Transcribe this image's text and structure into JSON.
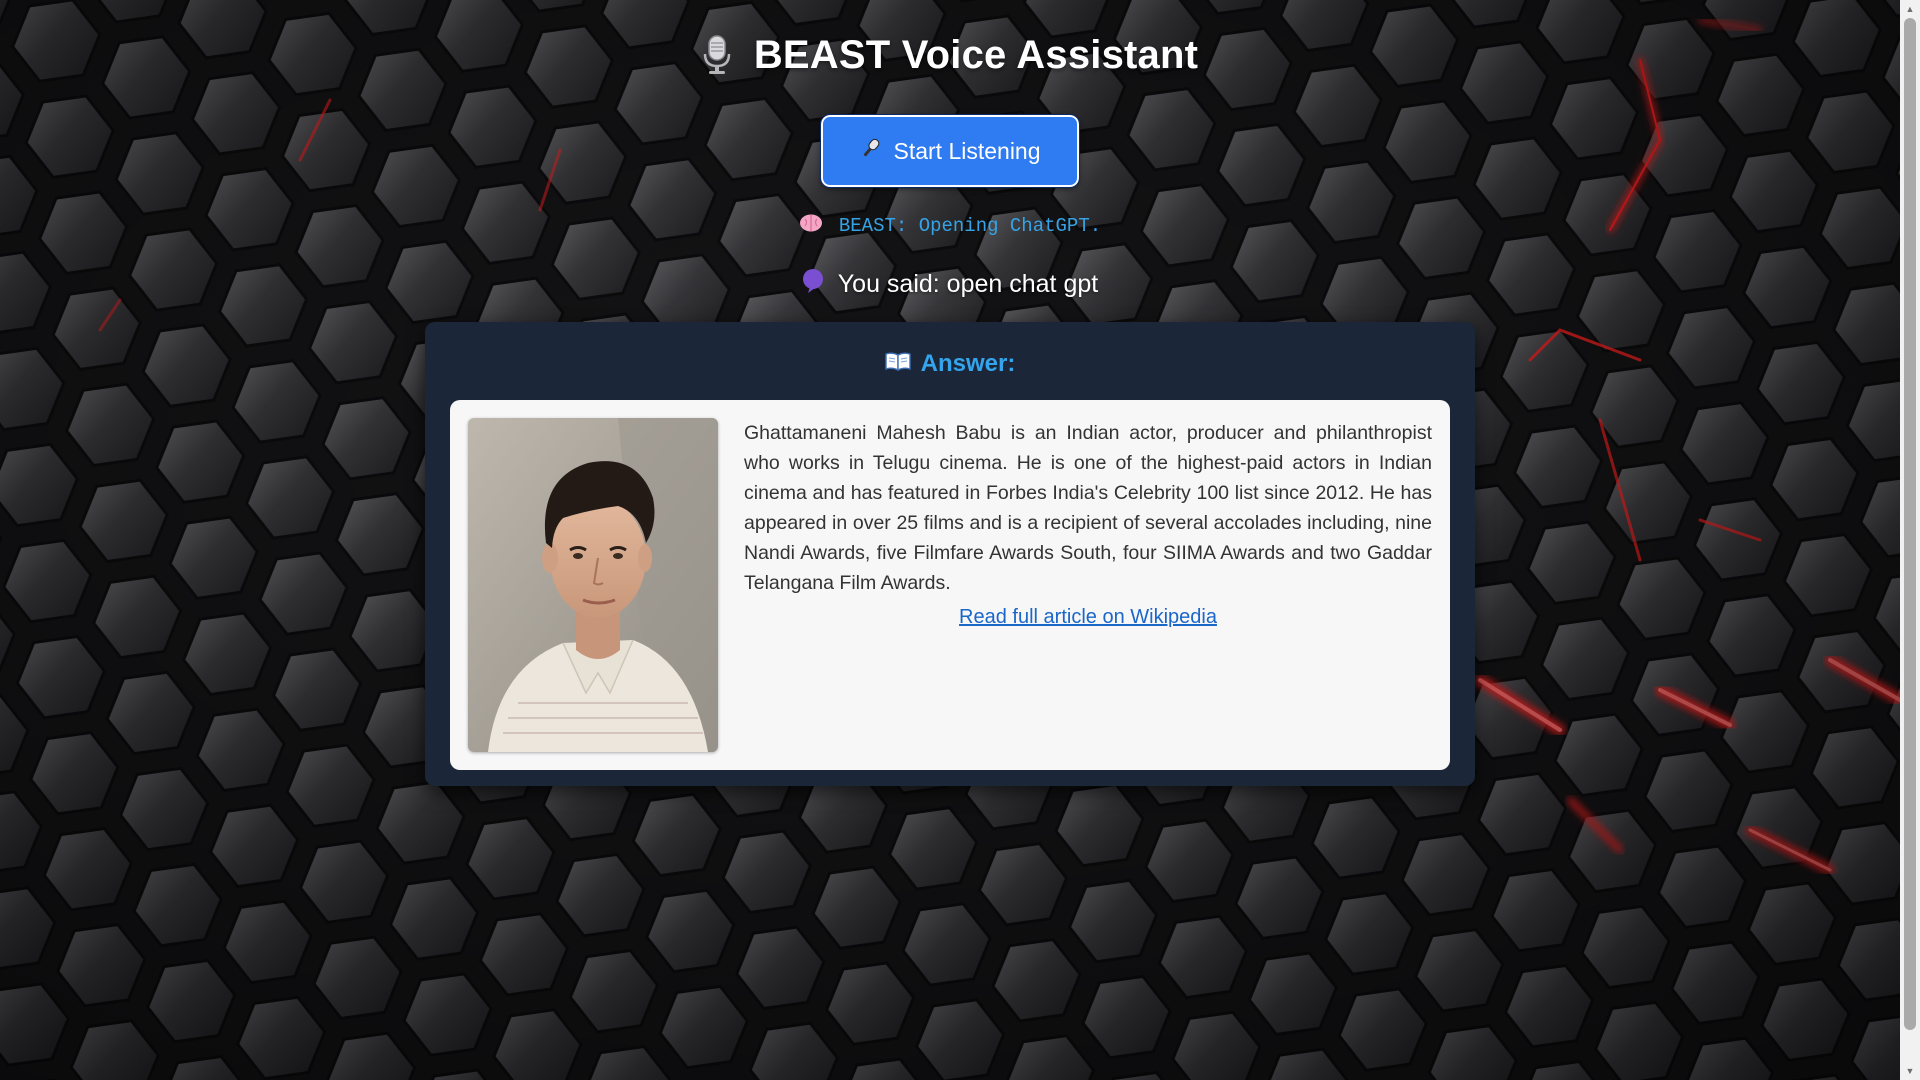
{
  "app": {
    "title": "BEAST Voice Assistant"
  },
  "controls": {
    "listen_button_label": "Start Listening"
  },
  "status": {
    "assistant_message": "BEAST: Opening ChatGPT.",
    "user_transcript": "You said: open chat gpt"
  },
  "answer": {
    "heading": "Answer:",
    "text": "Ghattamaneni Mahesh Babu is an Indian actor, producer and philanthropist who works in Telugu cinema. He is one of the highest-paid actors in Indian cinema and has featured in Forbes India's Celebrity 100 list since 2012. He has appeared in over 25 films and is a recipient of several accolades including, nine Nandi Awards, five Filmfare Awards South, four SIIMA Awards and two Gaddar Telangana Film Awards.",
    "link_label": "Read full article on Wikipedia"
  },
  "icons": {
    "title": "microphone-icon",
    "button": "microphone-icon",
    "status": "brain-icon",
    "transcript": "speech-bubble-icon",
    "answer": "book-icon"
  },
  "colors": {
    "accent_button": "#2f7bf2",
    "status_text": "#35a3e6",
    "answer_heading": "#34a4ec",
    "panel_bg": "#1b2638",
    "card_bg": "#f7f7f8",
    "link": "#1a66c9",
    "glow": "#ff1a1a"
  }
}
